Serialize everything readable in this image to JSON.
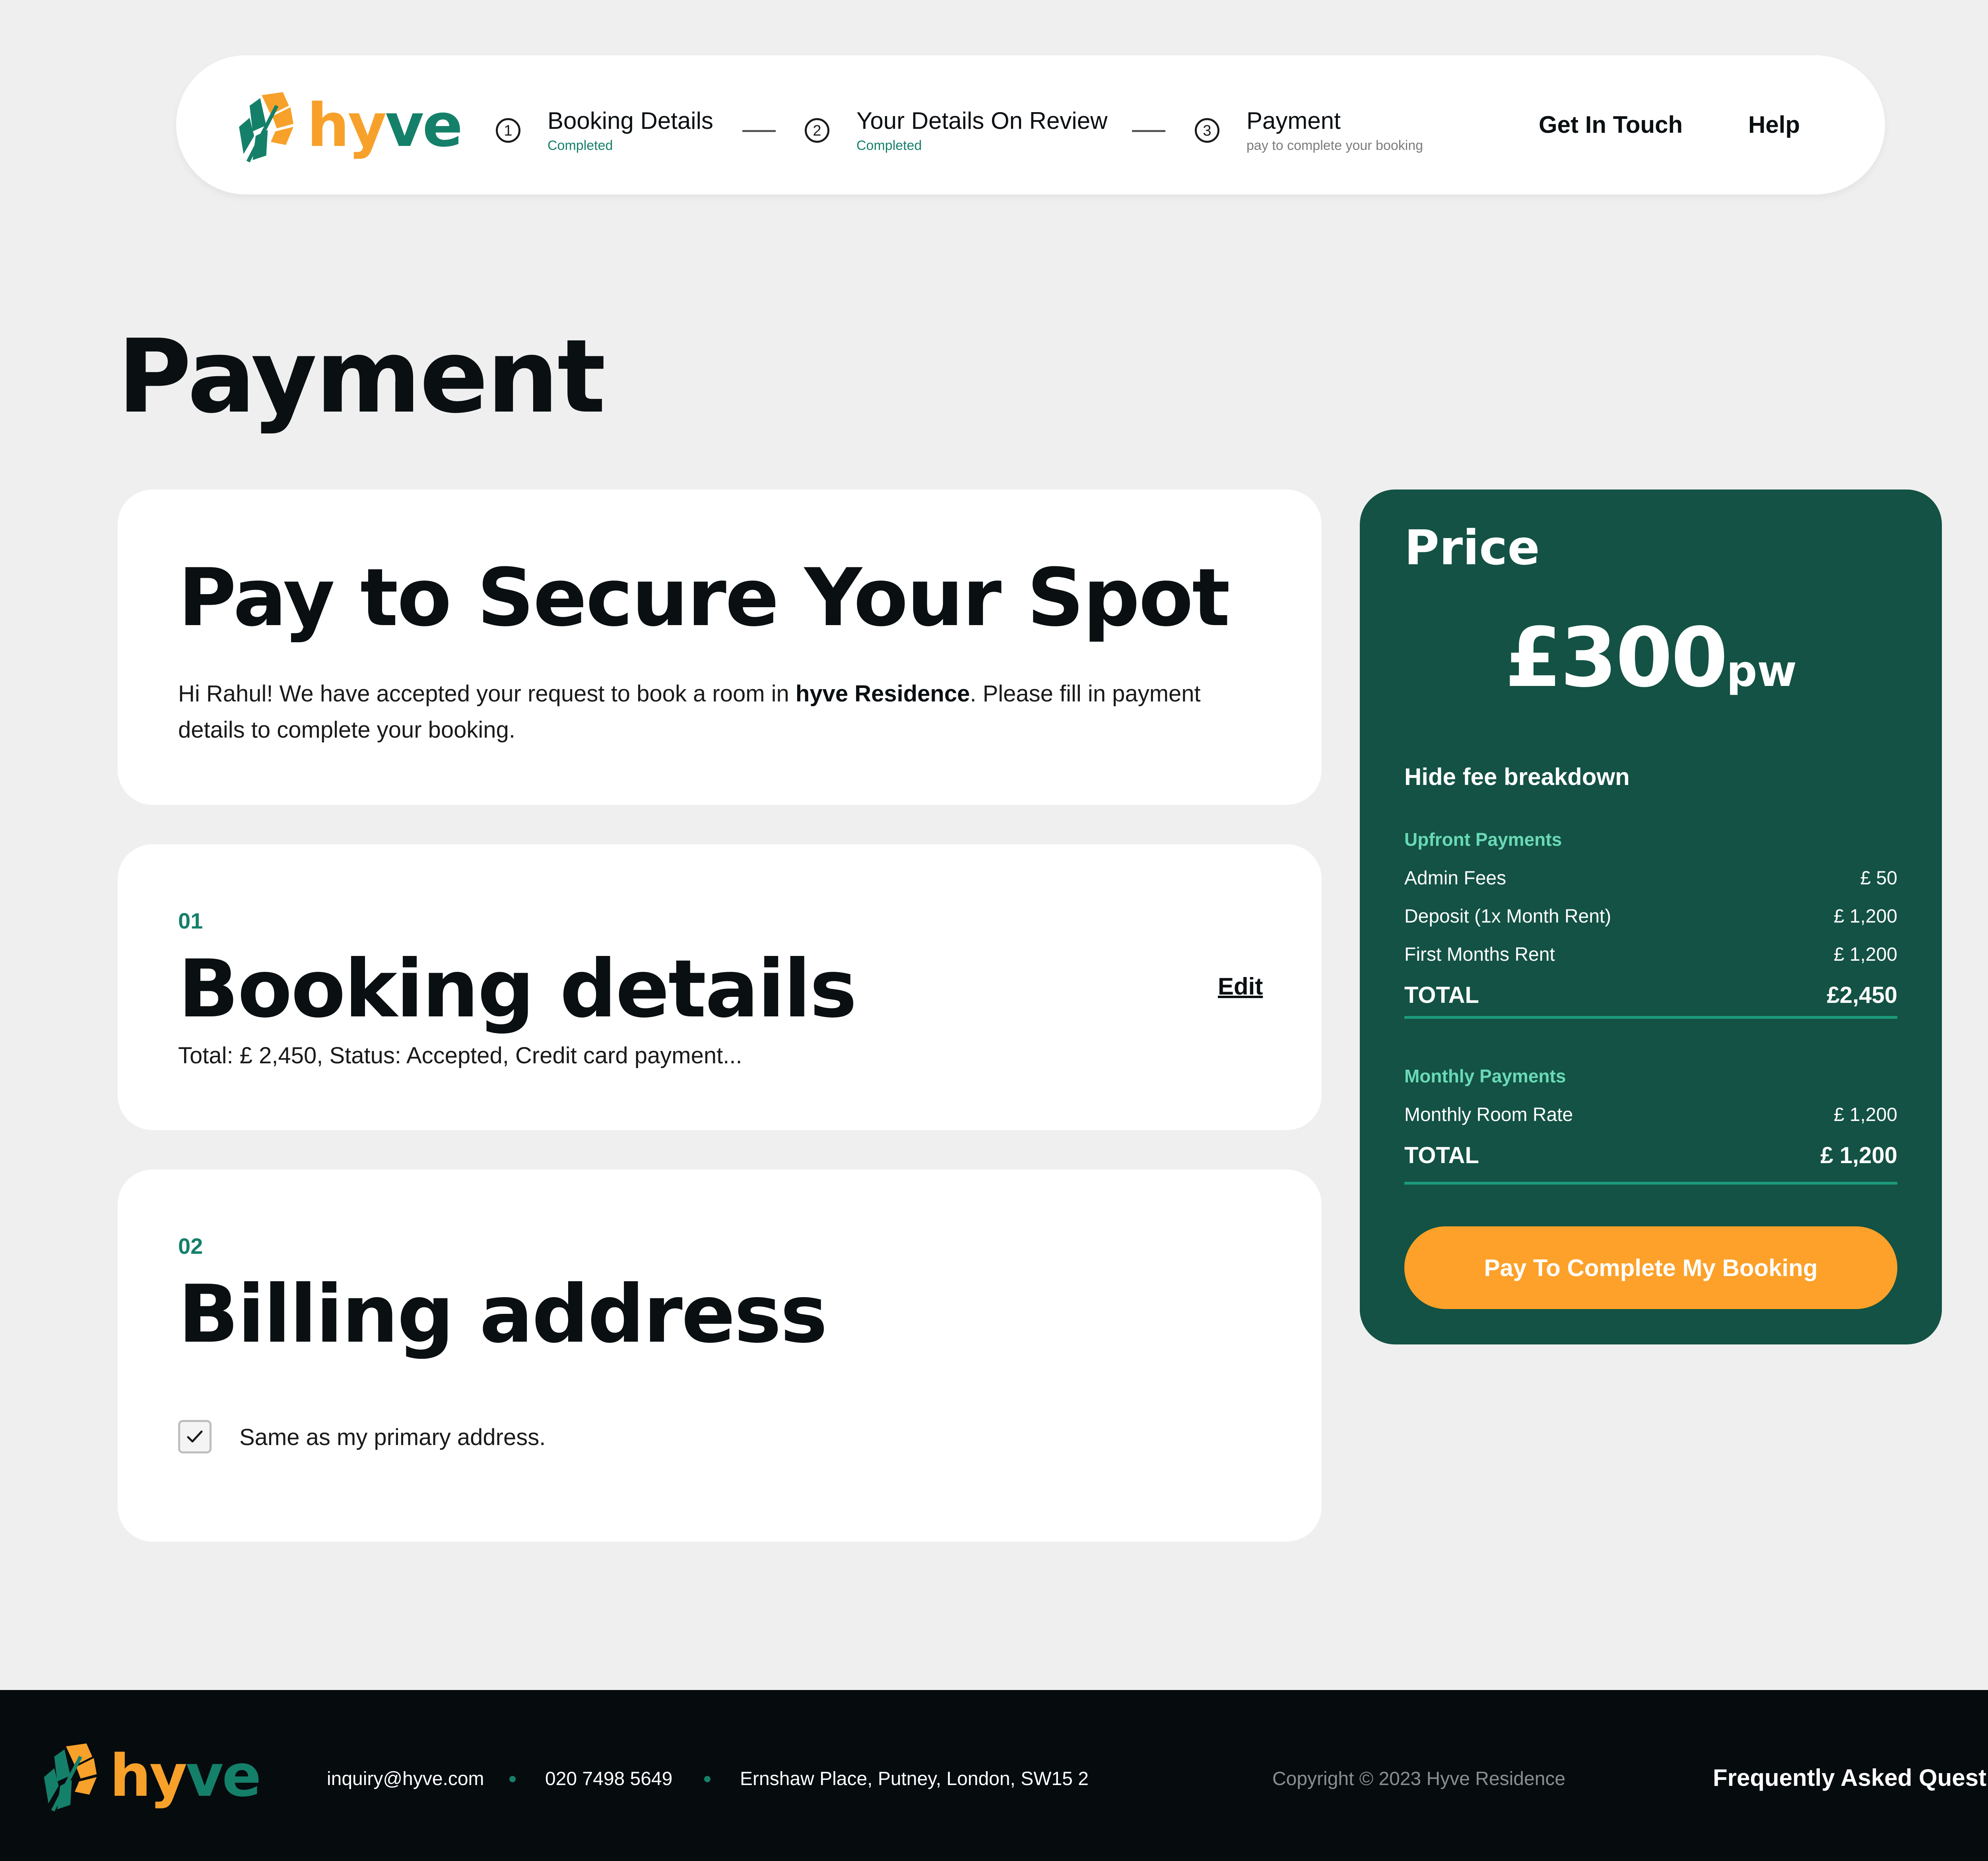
{
  "brand": {
    "name_part1": "hy",
    "name_part2": "ve",
    "logo_icon": "leaf-icon",
    "colors": {
      "orange": "#f7a12a",
      "green": "#15806a",
      "dark_green": "#135244",
      "button": "#fda12a"
    }
  },
  "header": {
    "steps": [
      {
        "number": "1",
        "title": "Booking Details",
        "subtitle": "Completed"
      },
      {
        "number": "2",
        "title": "Your Details On Review",
        "subtitle": "Completed"
      },
      {
        "number": "3",
        "title": "Payment",
        "subtitle": "pay to complete your booking"
      }
    ],
    "links": {
      "contact": "Get In Touch",
      "help": "Help"
    }
  },
  "page": {
    "title": "Payment"
  },
  "intro_card": {
    "heading": "Pay to Secure Your Spot",
    "text_before": "Hi Rahul! We have accepted your request to book a room in ",
    "text_bold": "hyve Residence",
    "text_after": ". Please fill in payment details to complete your booking."
  },
  "booking_card": {
    "number": "01",
    "heading": "Booking details",
    "edit_label": "Edit",
    "summary": "Total: £ 2,450, Status: Accepted, Credit card payment..."
  },
  "billing_card": {
    "number": "02",
    "heading": "Billing address",
    "checkbox_label": "Same as my primary address.",
    "checkbox_checked": true
  },
  "price_panel": {
    "title": "Price",
    "amount": "£300",
    "unit": "pw",
    "toggle_label": "Hide fee breakdown",
    "upfront": {
      "heading": "Upfront Payments",
      "rows": [
        {
          "label": "Admin Fees",
          "value": "£ 50"
        },
        {
          "label": "Deposit (1x Month Rent)",
          "value": "£ 1,200"
        },
        {
          "label": "First Months Rent",
          "value": "£ 1,200"
        }
      ],
      "total_label": "TOTAL",
      "total_value": "£2,450"
    },
    "monthly": {
      "heading": "Monthly Payments",
      "rows": [
        {
          "label": "Monthly Room Rate",
          "value": "£ 1,200"
        }
      ],
      "total_label": "TOTAL",
      "total_value": "£ 1,200"
    },
    "button_label": "Pay To Complete My Booking"
  },
  "footer": {
    "email": "inquiry@hyve.com",
    "phone": "020 7498 5649",
    "address": "Ernshaw Place, Putney, London, SW15 2",
    "copyright": "Copyright © 2023 Hyve Residence",
    "faq": "Frequently Asked Questions"
  }
}
